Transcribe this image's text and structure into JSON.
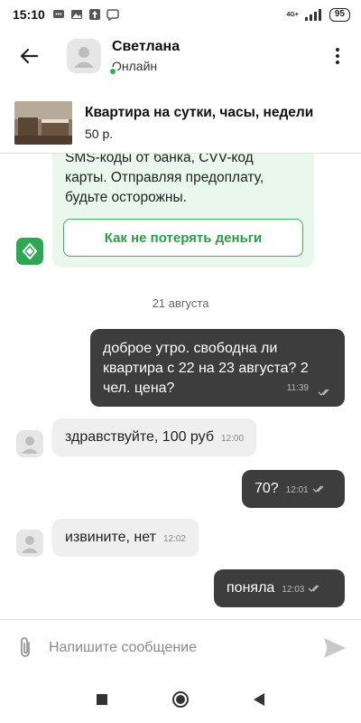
{
  "status_bar": {
    "time": "15:10",
    "battery": "95",
    "network": "4G+"
  },
  "header": {
    "name": "Светлана",
    "status": "Онлайн"
  },
  "listing": {
    "title": "Квартира на сутки, часы, недели",
    "price": "50 р."
  },
  "warning": {
    "line1": "SMS-коды от банка, CVV-код",
    "line2": "карты. Отправляя предоплату,",
    "line3": "будьте осторожны.",
    "button_label": "Как не потерять деньги"
  },
  "date_separator": "21 августа",
  "messages": [
    {
      "direction": "out",
      "text": "доброе утро. свободна ли квартира с 22 на 23 августа? 2 чел. цена?",
      "time": "11:39"
    },
    {
      "direction": "in",
      "text": "здравствуйте, 100 руб",
      "time": "12:00"
    },
    {
      "direction": "out",
      "text": "70?",
      "time": "12:01"
    },
    {
      "direction": "in",
      "text": "извините, нет",
      "time": "12:02"
    },
    {
      "direction": "out",
      "text": "поняла",
      "time": "12:03"
    }
  ],
  "composer": {
    "placeholder": "Напишите сообщение"
  },
  "colors": {
    "accent_green": "#2fa652",
    "outgoing_bubble": "#3d3d3d",
    "incoming_bubble": "#efefef",
    "warning_bg": "#e9f7ed"
  },
  "icons": [
    "whatsapp-icon",
    "gallery-icon",
    "upload-icon",
    "viber-icon",
    "back-arrow-icon",
    "more-icon",
    "shield-icon",
    "attach-icon",
    "send-icon",
    "nav-recents-icon",
    "nav-home-icon",
    "nav-back-icon"
  ]
}
